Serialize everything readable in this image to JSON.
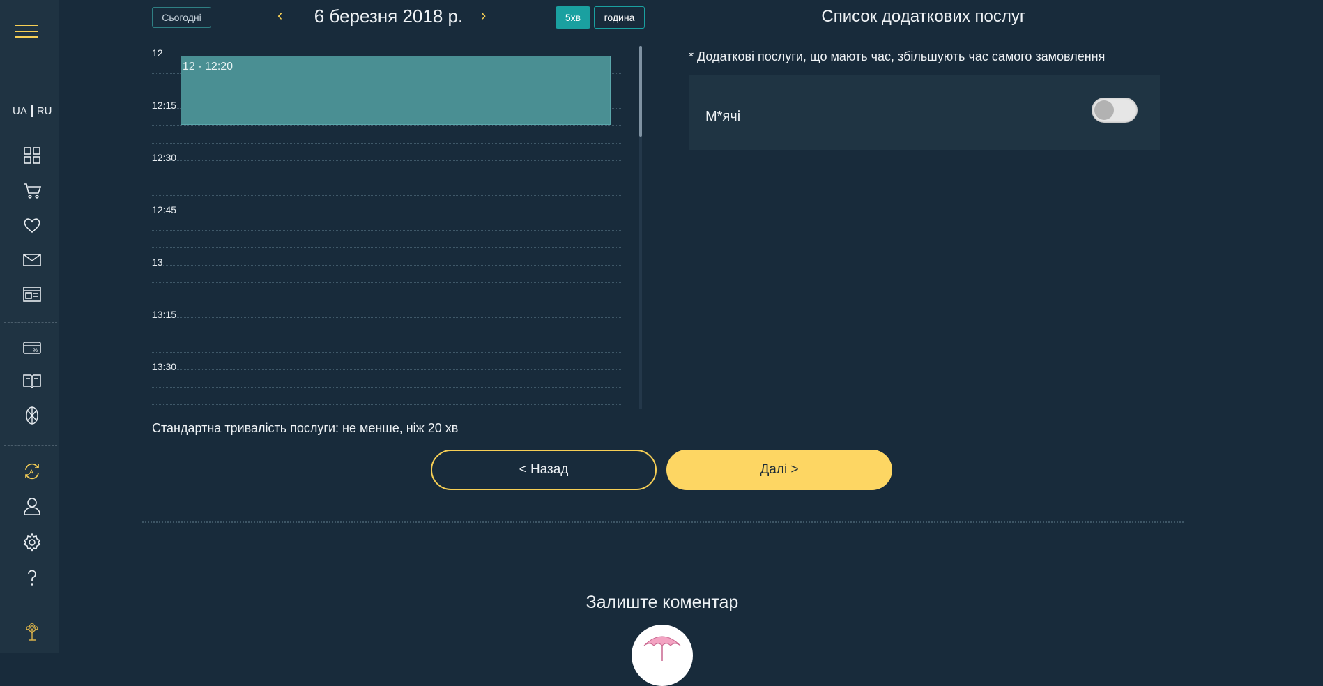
{
  "sidebar": {
    "lang_ua": "UA",
    "lang_ru": "RU",
    "icons": [
      "dashboard-icon",
      "cart-icon",
      "heart-icon",
      "mail-icon",
      "news-icon",
      "card-discount-icon",
      "book-icon",
      "aperture-icon",
      "refresh-a-icon",
      "user-icon",
      "gear-icon",
      "help-icon",
      "tree-logo-icon"
    ]
  },
  "toolbar": {
    "today_label": "Сьогодні",
    "prev_arrow": "‹",
    "next_arrow": "›",
    "date": "6 березня 2018 р.",
    "scale_5min": "5хв",
    "scale_hour": "година"
  },
  "schedule": {
    "time_labels": [
      "12",
      "12:15",
      "12:30",
      "12:45",
      "13",
      "13:15",
      "13:30"
    ],
    "booking_label": "12 - 12:20"
  },
  "services": {
    "title": "Список додаткових послуг",
    "note": "* Додаткові послуги, що мають час, збільшують час самого замовлення",
    "items": [
      {
        "name": "М*ячі",
        "enabled": false
      }
    ]
  },
  "footer": {
    "duration_text": "Стандартна тривалість послуги: не менше, ніж 20 хв",
    "back_label": "< Назад",
    "next_label": "Далі   >",
    "comment_title": "Залиште коментар"
  },
  "colors": {
    "accent": "#f6cf55",
    "teal": "#1aa0a0",
    "background": "#182b3b",
    "sidebar": "#1f3342"
  }
}
